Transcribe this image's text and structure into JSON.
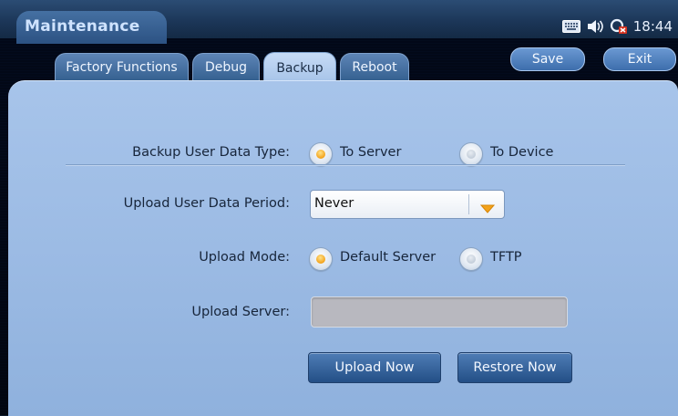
{
  "app": {
    "title": "Maintenance"
  },
  "status": {
    "time": "18:44",
    "icons": [
      "keyboard-icon",
      "speaker-icon",
      "network-alert-icon"
    ]
  },
  "tabs": [
    {
      "label": "Factory Functions",
      "active": false
    },
    {
      "label": "Debug",
      "active": false
    },
    {
      "label": "Backup",
      "active": true
    },
    {
      "label": "Reboot",
      "active": false
    }
  ],
  "actions": {
    "save": "Save",
    "exit": "Exit"
  },
  "backup_type": {
    "label": "Backup User Data Type:",
    "options": [
      {
        "label": "To Server",
        "selected": true
      },
      {
        "label": "To Device",
        "selected": false
      }
    ]
  },
  "upload_period": {
    "label": "Upload User Data Period:",
    "value": "Never"
  },
  "upload_mode": {
    "label": "Upload Mode:",
    "options": [
      {
        "label": "Default Server",
        "selected": true
      },
      {
        "label": "TFTP",
        "selected": false
      }
    ]
  },
  "upload_server": {
    "label": "Upload Server:",
    "value": ""
  },
  "buttons": {
    "upload_now": "Upload Now",
    "restore_now": "Restore Now"
  },
  "colors": {
    "accent_radio": "#f3a21a",
    "panel": "#9cbbe4",
    "button": "#234f86"
  }
}
